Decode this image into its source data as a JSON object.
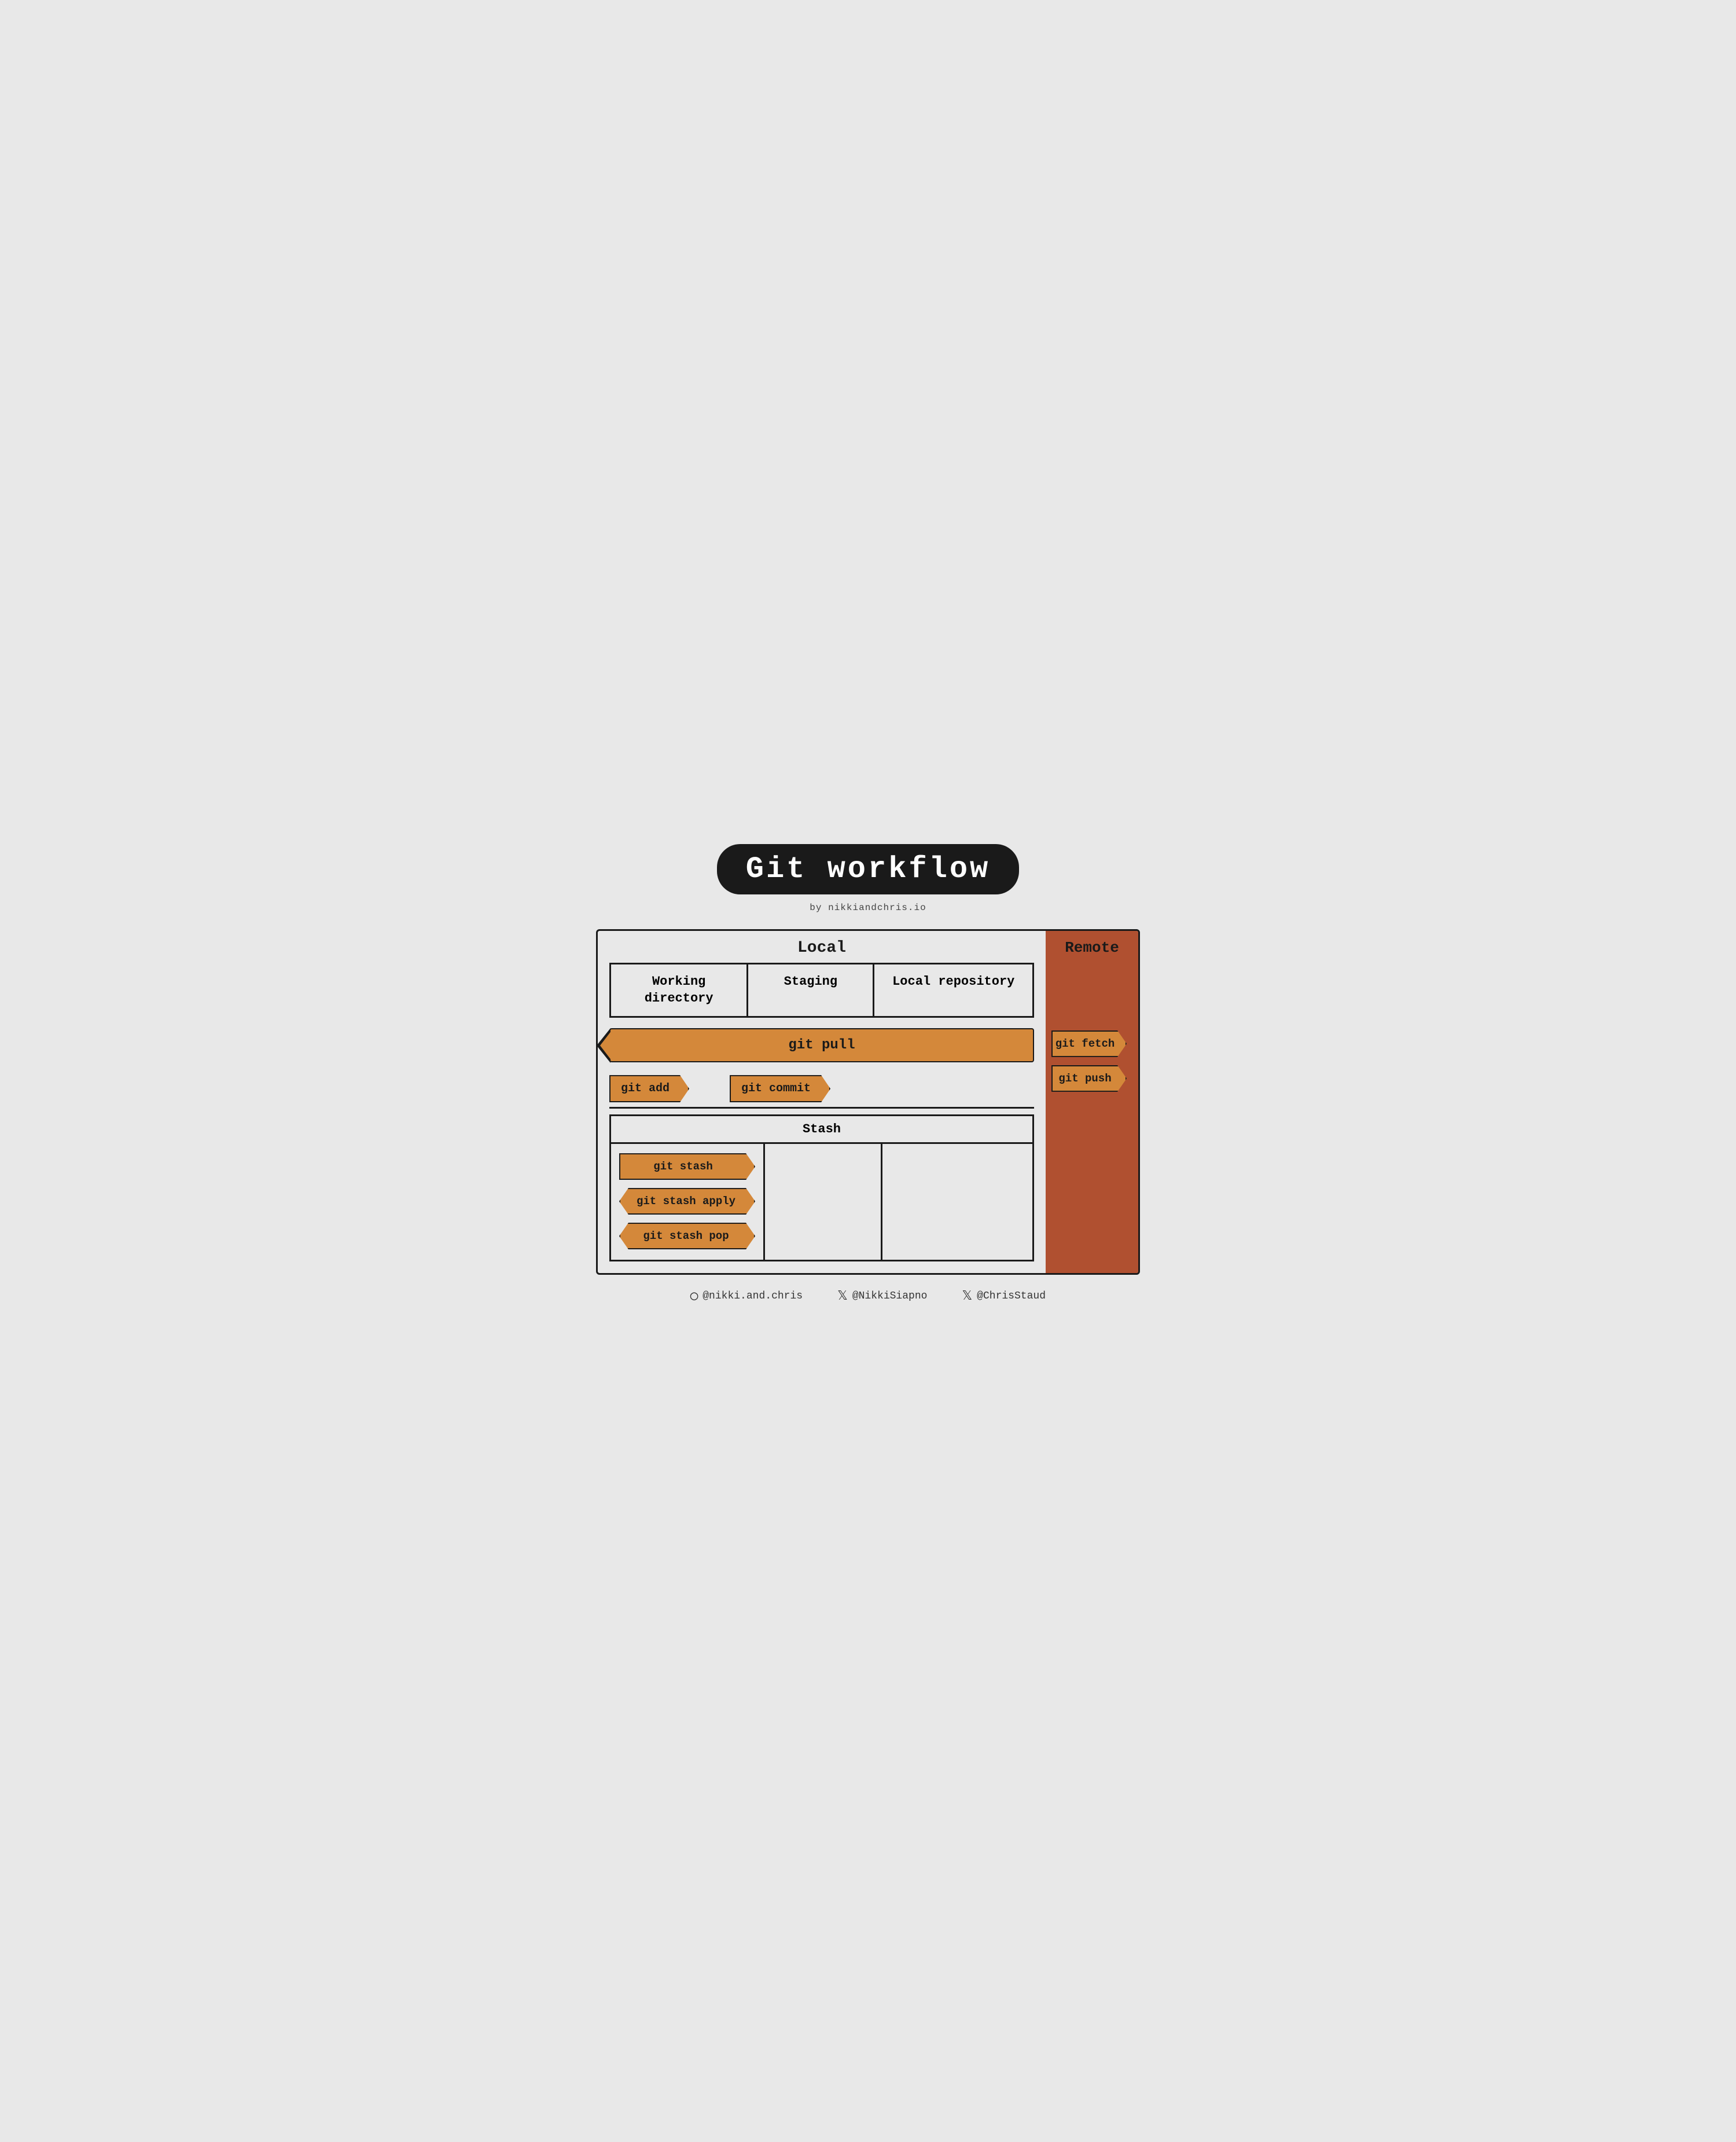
{
  "title": "Git workflow",
  "subtitle": "by nikkiandchris.io",
  "sections": {
    "local": "Local",
    "remote": "Remote"
  },
  "columns": {
    "working": "Working directory",
    "staging": "Staging",
    "localRepo": "Local repository"
  },
  "stash": {
    "label": "Stash"
  },
  "commands": {
    "gitPull": "git pull",
    "gitAdd": "git add",
    "gitCommit": "git commit",
    "gitFetch": "git fetch",
    "gitPush": "git push",
    "gitStash": "git stash",
    "gitStashApply": "git stash apply",
    "gitStashPop": "git stash pop"
  },
  "footer": {
    "instagram": "@nikki.and.chris",
    "twitter1": "@NikkiSiapno",
    "twitter2": "@ChrisStaud"
  }
}
